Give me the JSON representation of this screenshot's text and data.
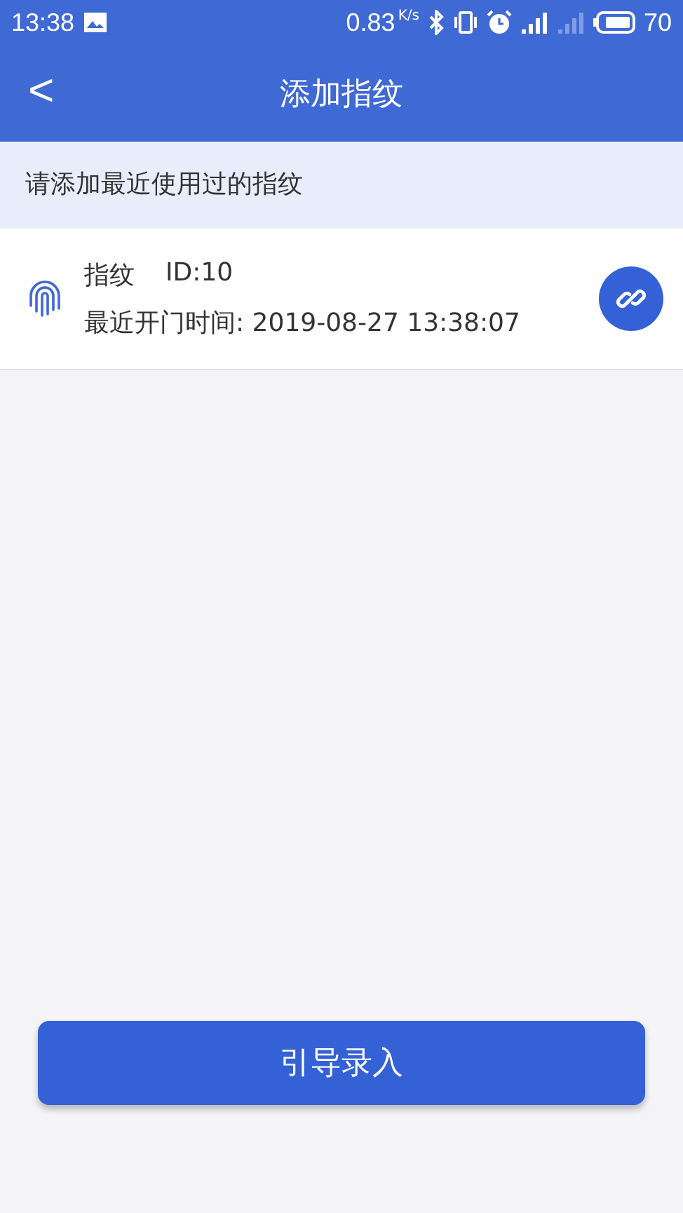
{
  "status_bar": {
    "time": "13:38",
    "speed": "0.83",
    "speed_unit": "K/s",
    "battery": "70"
  },
  "header": {
    "back": "<",
    "title": "添加指纹"
  },
  "notice": "请添加最近使用过的指纹",
  "fingerprints": [
    {
      "name": "指纹",
      "id": "ID:10",
      "last_open": "最近开门时间: 2019-08-27 13:38:07"
    }
  ],
  "primary_button": "引导录入"
}
